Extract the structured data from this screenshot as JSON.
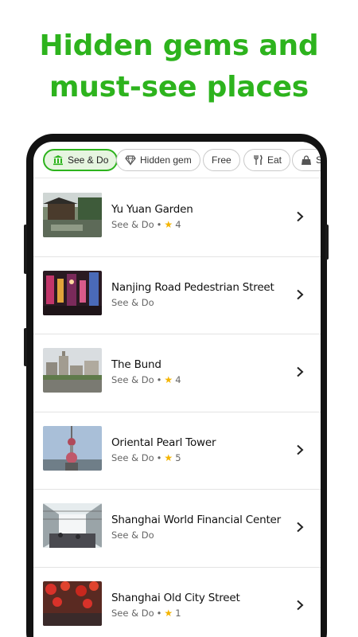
{
  "headline": {
    "line1": "Hidden gems and",
    "line2": "must-see places"
  },
  "colors": {
    "brand_green": "#2db31d",
    "chip_active_bg": "#e6f5e0",
    "star": "#f4b400"
  },
  "chips": [
    {
      "label": "See & Do",
      "icon": "museum-icon",
      "active": true
    },
    {
      "label": "Hidden gem",
      "icon": "diamond-icon",
      "active": false
    },
    {
      "label": "Free",
      "icon": "",
      "active": false
    },
    {
      "label": "Eat",
      "icon": "fork-knife-icon",
      "active": false
    },
    {
      "label": "S",
      "icon": "shopping-bag-icon",
      "active": false
    }
  ],
  "places": [
    {
      "name": "Yu Yuan Garden",
      "category": "See & Do",
      "separator": "•",
      "rating": "4"
    },
    {
      "name": "Nanjing Road Pedestrian Street",
      "category": "See & Do",
      "separator": "",
      "rating": ""
    },
    {
      "name": "The Bund",
      "category": "See & Do",
      "separator": "•",
      "rating": "4"
    },
    {
      "name": "Oriental Pearl Tower",
      "category": "See & Do",
      "separator": "•",
      "rating": "5"
    },
    {
      "name": "Shanghai World Financial Center",
      "category": "See & Do",
      "separator": "",
      "rating": ""
    },
    {
      "name": "Shanghai Old City Street",
      "category": "See & Do",
      "separator": "•",
      "rating": "1"
    }
  ]
}
